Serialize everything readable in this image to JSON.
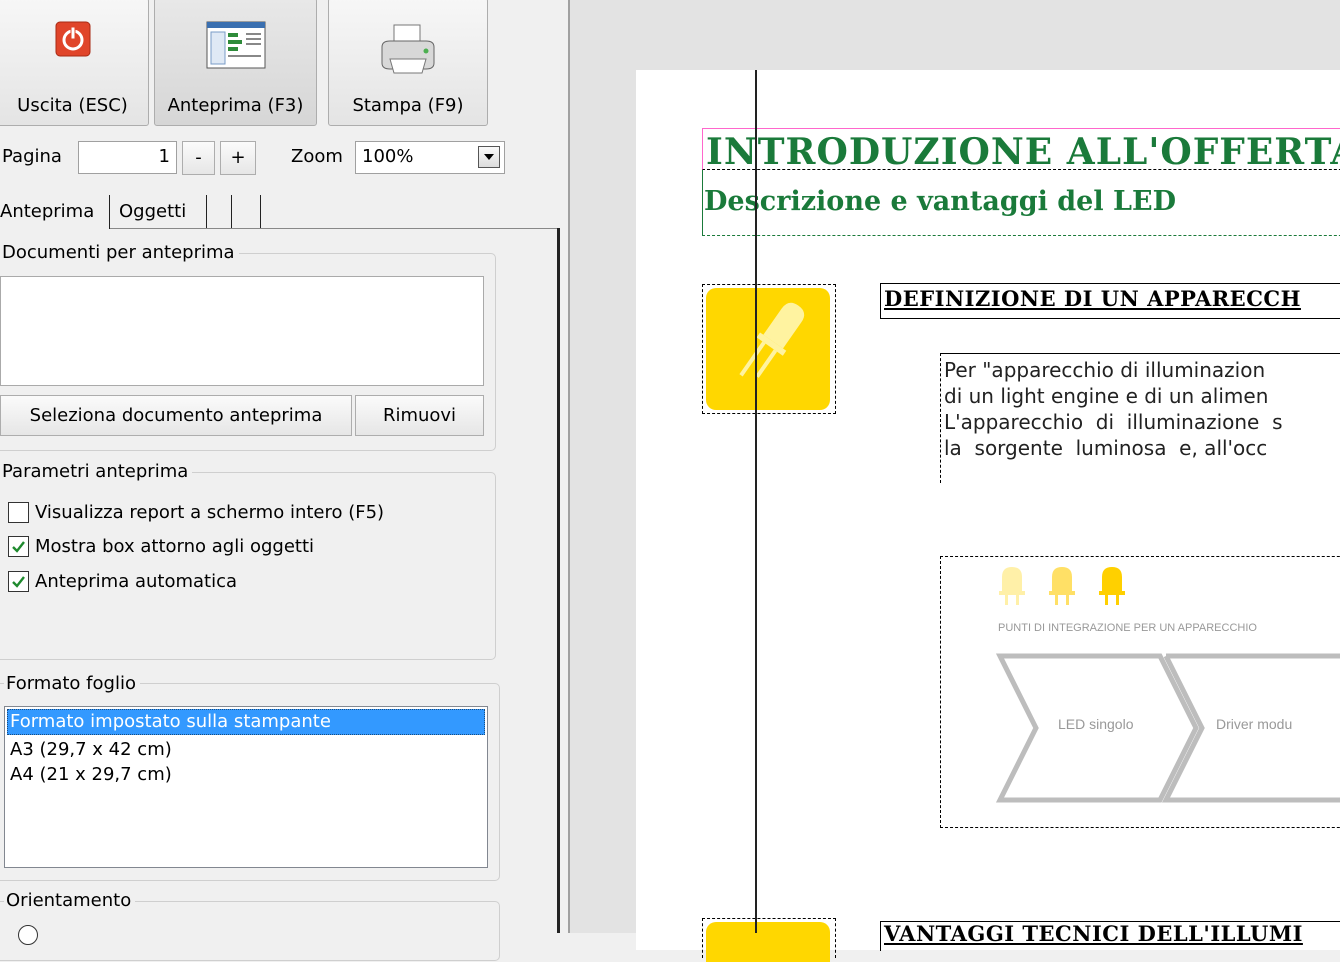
{
  "toolbar": {
    "exit_label": "Uscita (ESC)",
    "preview_label": "Anteprima (F3)",
    "print_label": "Stampa (F9)"
  },
  "pager": {
    "page_label": "Pagina",
    "page_value": "1",
    "minus_label": "-",
    "plus_label": "+",
    "zoom_label": "Zoom",
    "zoom_value": "100%"
  },
  "tabs": [
    "Anteprima",
    "Oggetti",
    "",
    ""
  ],
  "documents": {
    "group_title": "Documenti per anteprima",
    "select_label": "Seleziona documento anteprima",
    "remove_label": "Rimuovi"
  },
  "params": {
    "group_title": "Parametri anteprima",
    "options": [
      {
        "label": "Visualizza report a schermo intero (F5)",
        "checked": false
      },
      {
        "label": "Mostra box attorno agli oggetti",
        "checked": true
      },
      {
        "label": "Anteprima automatica",
        "checked": true
      }
    ]
  },
  "sheet_format": {
    "group_title": "Formato foglio",
    "items": [
      "Formato impostato sulla stampante",
      "A3 (29,7 x 42 cm)",
      "A4 (21 x 29,7 cm)"
    ],
    "selected_index": 0
  },
  "orientation": {
    "group_title": "Orientamento"
  },
  "preview": {
    "title": "INTRODUZIONE ALL'OFFERTA",
    "subtitle": "Descrizione e vantaggi del LED",
    "section1_heading": "DEFINIZIONE DI UN APPARECCH",
    "body_lines": [
      "Per \"apparecchio di illuminazion",
      "di un light engine e di un alimen",
      "L'apparecchio  di  illuminazione  s",
      "la  sorgente  luminosa  e, all'occ"
    ],
    "infographic_caption": "PUNTI DI INTEGRAZIONE PER UN APPARECCHIO",
    "chevron1_label": "LED singolo",
    "chevron2_label": "Driver modu",
    "section2_heading": "VANTAGGI TECNICI DELL'ILLUMI"
  },
  "colors": {
    "title_green": "#1a7a3a",
    "accent_yellow": "#ffd700",
    "exit_red": "#e0452a",
    "selection_blue": "#3399ff",
    "pink_box": "#ff66cc"
  }
}
